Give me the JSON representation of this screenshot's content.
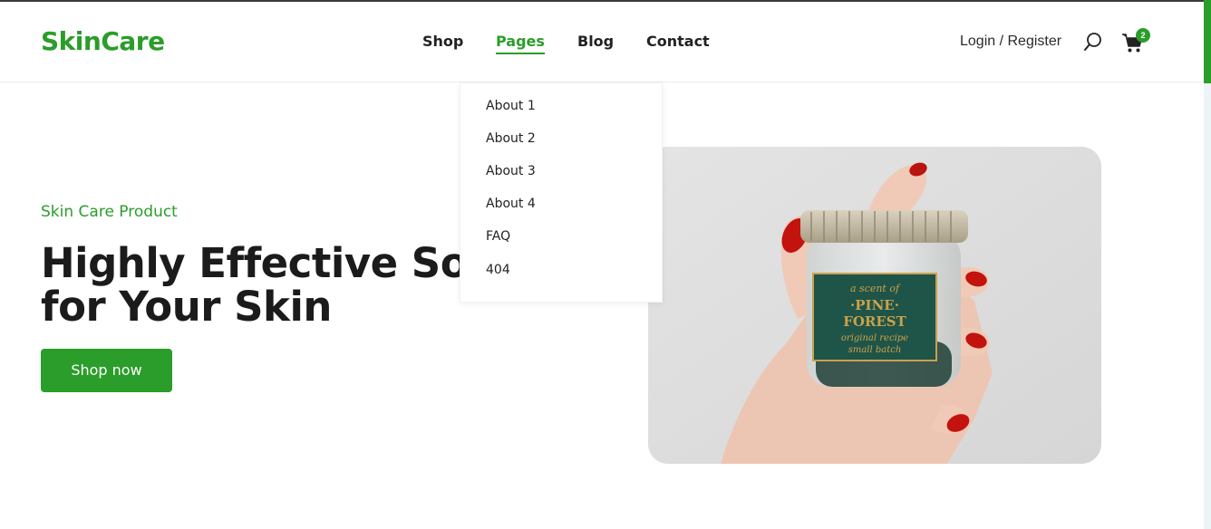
{
  "header": {
    "logo": "SkinCare",
    "nav": [
      {
        "label": "Shop",
        "active": false
      },
      {
        "label": "Pages",
        "active": true
      },
      {
        "label": "Blog",
        "active": false
      },
      {
        "label": "Contact",
        "active": false
      }
    ],
    "login_label": "Login / Register",
    "cart_count": "2",
    "icons": {
      "search": "search-icon",
      "cart": "cart-icon"
    }
  },
  "dropdown": {
    "items": [
      "About 1",
      "About 2",
      "About 3",
      "About 4",
      "FAQ",
      "404"
    ]
  },
  "hero": {
    "eyebrow": "Skin Care Product",
    "headline_line1": "Highly Effective Solutions",
    "headline_line2": "for Your Skin",
    "cta_label": "Shop now",
    "image": {
      "label_line1": "a scent of",
      "label_line2": "·PINE·",
      "label_line3": "FOREST",
      "label_line4": "original recipe",
      "label_line5": "small batch"
    }
  },
  "colors": {
    "brand": "#2a9d2a",
    "text": "#1b1b1b",
    "label_bg": "#1f5448",
    "label_gold": "#c9a24d"
  }
}
